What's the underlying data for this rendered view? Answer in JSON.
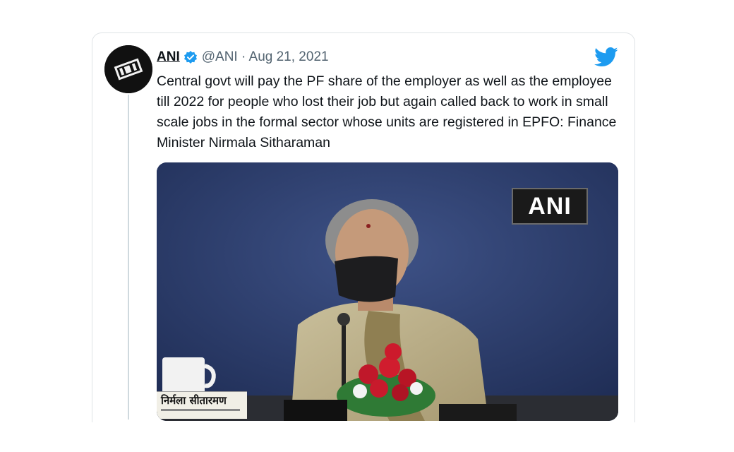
{
  "tweet": {
    "author_name": "ANI",
    "handle_date": "@ANI · Aug 21, 2021",
    "text": "Central govt will pay the PF share of the employer as well as the employee till 2022 for people who lost their job but again called back to work in small scale jobs in the formal sector whose units are registered in EPFO: Finance Minister Nirmala Sitharaman",
    "verified_icon": "verified-badge-icon",
    "brand_icon": "twitter-bird-icon"
  },
  "media": {
    "watermark": "ANI",
    "name_plate": "निर्मला सीतारमण"
  },
  "colors": {
    "twitter_blue": "#1d9bf0",
    "text": "#0f1419",
    "secondary_text": "#536471",
    "border": "#dfe3e6"
  }
}
